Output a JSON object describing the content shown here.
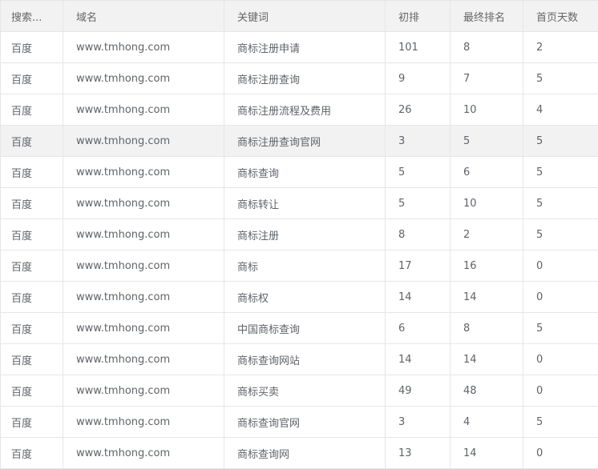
{
  "columns": [
    "搜索...",
    "域名",
    "关键词",
    "初排",
    "最终排名",
    "首页天数"
  ],
  "rows": [
    {
      "engine": "百度",
      "domain": "www.tmhong.com",
      "keyword": "商标注册申请",
      "initial": "101",
      "final": "8",
      "days": "2"
    },
    {
      "engine": "百度",
      "domain": "www.tmhong.com",
      "keyword": "商标注册查询",
      "initial": "9",
      "final": "7",
      "days": "5"
    },
    {
      "engine": "百度",
      "domain": "www.tmhong.com",
      "keyword": "商标注册流程及费用",
      "initial": "26",
      "final": "10",
      "days": "4"
    },
    {
      "engine": "百度",
      "domain": "www.tmhong.com",
      "keyword": "商标注册查询官网",
      "initial": "3",
      "final": "5",
      "days": "5"
    },
    {
      "engine": "百度",
      "domain": "www.tmhong.com",
      "keyword": "商标查询",
      "initial": "5",
      "final": "6",
      "days": "5"
    },
    {
      "engine": "百度",
      "domain": "www.tmhong.com",
      "keyword": "商标转让",
      "initial": "5",
      "final": "10",
      "days": "5"
    },
    {
      "engine": "百度",
      "domain": "www.tmhong.com",
      "keyword": "商标注册",
      "initial": "8",
      "final": "2",
      "days": "5"
    },
    {
      "engine": "百度",
      "domain": "www.tmhong.com",
      "keyword": "商标",
      "initial": "17",
      "final": "16",
      "days": "0"
    },
    {
      "engine": "百度",
      "domain": "www.tmhong.com",
      "keyword": "商标权",
      "initial": "14",
      "final": "14",
      "days": "0"
    },
    {
      "engine": "百度",
      "domain": "www.tmhong.com",
      "keyword": "中国商标查询",
      "initial": "6",
      "final": "8",
      "days": "5"
    },
    {
      "engine": "百度",
      "domain": "www.tmhong.com",
      "keyword": "商标查询网站",
      "initial": "14",
      "final": "14",
      "days": "0"
    },
    {
      "engine": "百度",
      "domain": "www.tmhong.com",
      "keyword": "商标买卖",
      "initial": "49",
      "final": "48",
      "days": "0"
    },
    {
      "engine": "百度",
      "domain": "www.tmhong.com",
      "keyword": "商标查询官网",
      "initial": "3",
      "final": "4",
      "days": "5"
    },
    {
      "engine": "百度",
      "domain": "www.tmhong.com",
      "keyword": "商标查询网",
      "initial": "13",
      "final": "14",
      "days": "0"
    }
  ],
  "highlight_row_index": 3,
  "colors": {
    "header_bg": "#f2f2f2",
    "highlight_bg": "#f2f2f2",
    "border": "#e6e6e6",
    "text": "#5f6368"
  }
}
